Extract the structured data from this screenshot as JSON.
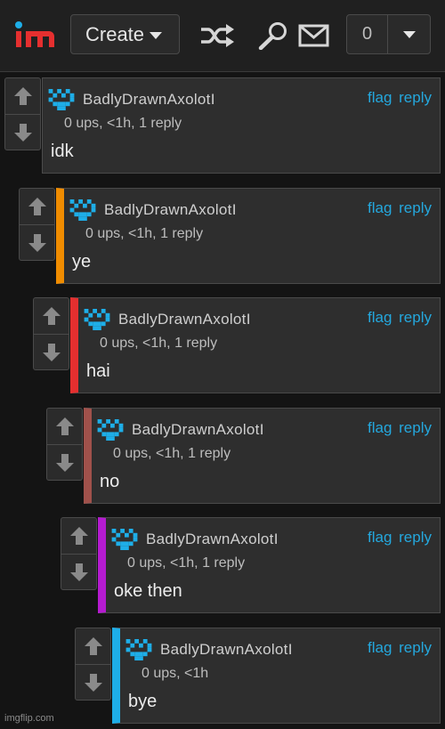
{
  "header": {
    "logo_text": "im",
    "create_label": "Create",
    "notification_count": "0"
  },
  "accent_colors": [
    "#f08c00",
    "#e52f2f",
    "#a0514b",
    "#b51bd0",
    "#1eaee8"
  ],
  "comments": [
    {
      "username": "BadlyDrawnAxolotI",
      "meta": "0 ups, <1h, 1 reply",
      "text": "idk",
      "flag": "flag",
      "reply": "reply"
    },
    {
      "username": "BadlyDrawnAxolotI",
      "meta": "0 ups, <1h, 1 reply",
      "text": "ye",
      "flag": "flag",
      "reply": "reply"
    },
    {
      "username": "BadlyDrawnAxolotI",
      "meta": "0 ups, <1h, 1 reply",
      "text": "hai",
      "flag": "flag",
      "reply": "reply"
    },
    {
      "username": "BadlyDrawnAxolotI",
      "meta": "0 ups, <1h, 1 reply",
      "text": "no",
      "flag": "flag",
      "reply": "reply"
    },
    {
      "username": "BadlyDrawnAxolotI",
      "meta": "0 ups, <1h, 1 reply",
      "text": "oke then",
      "flag": "flag",
      "reply": "reply"
    },
    {
      "username": "BadlyDrawnAxolotI",
      "meta": "0 ups, <1h",
      "text": "bye",
      "flag": "flag",
      "reply": "reply"
    }
  ],
  "watermark": "imgflip.com"
}
